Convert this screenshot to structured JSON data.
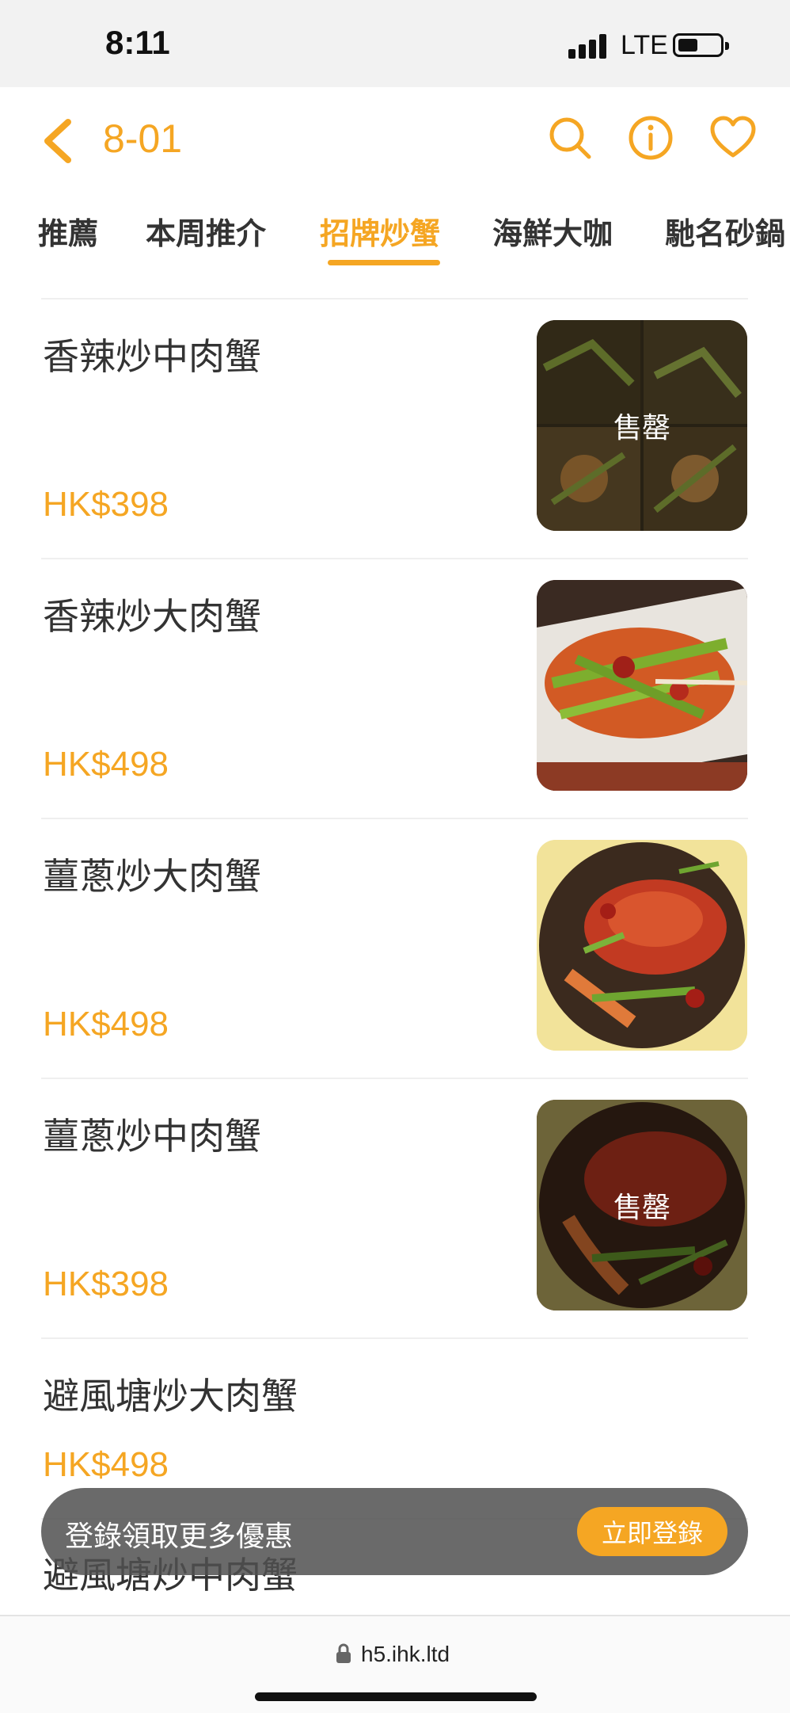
{
  "status_bar": {
    "time": "8:11",
    "network": "LTE"
  },
  "header": {
    "title": "8-01",
    "accent_color": "#f5a623",
    "icons": [
      "back-icon",
      "search-icon",
      "info-icon",
      "heart-icon"
    ]
  },
  "tabs": [
    {
      "label": "推薦",
      "active": false
    },
    {
      "label": "本周推介",
      "active": false
    },
    {
      "label": "招牌炒蟹",
      "active": true
    },
    {
      "label": "海鮮大咖",
      "active": false
    },
    {
      "label": "馳名砂鍋",
      "active": false
    }
  ],
  "items": [
    {
      "name": "香辣炒中肉蟹",
      "price": "HK$398",
      "sold_out": true,
      "sold_label": "售罄"
    },
    {
      "name": "香辣炒大肉蟹",
      "price": "HK$498",
      "sold_out": false
    },
    {
      "name": "薑蔥炒大肉蟹",
      "price": "HK$498",
      "sold_out": false
    },
    {
      "name": "薑蔥炒中肉蟹",
      "price": "HK$398",
      "sold_out": true,
      "sold_label": "售罄"
    },
    {
      "name": "避風塘炒大肉蟹",
      "price": "HK$498"
    },
    {
      "name": "避風塘炒中肉蟹"
    }
  ],
  "login_banner": {
    "text": "登錄領取更多優惠",
    "button": "立即登錄"
  },
  "browser": {
    "url": "h5.ihk.ltd"
  }
}
